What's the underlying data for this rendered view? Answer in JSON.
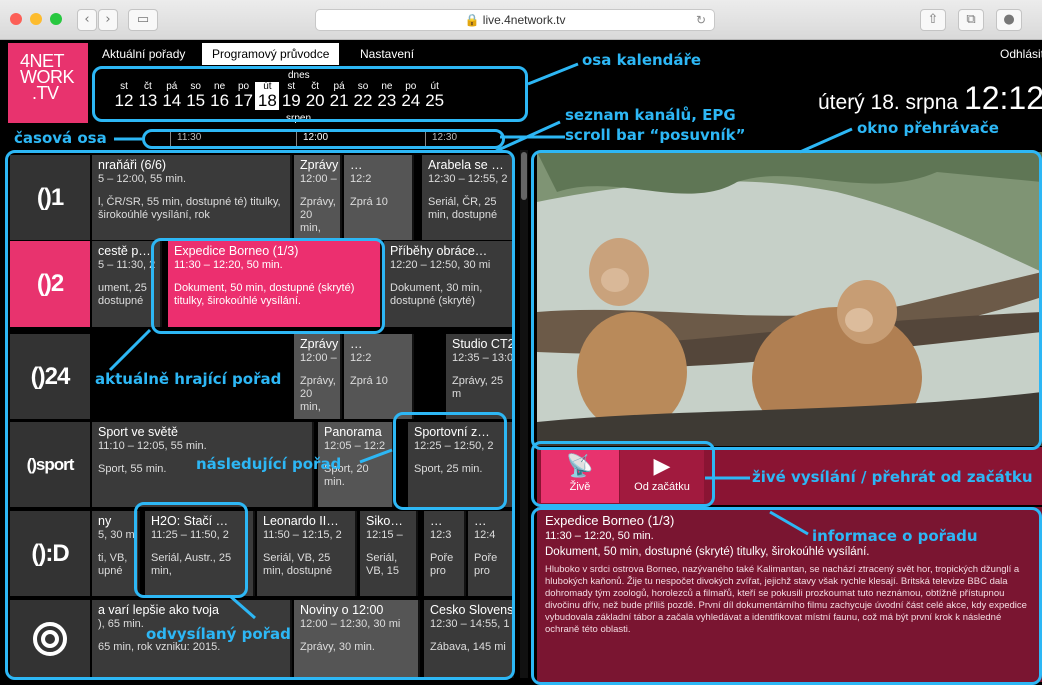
{
  "browser": {
    "url": "live.4network.tv",
    "icons": [
      "back-icon",
      "forward-icon",
      "sidebar-icon",
      "reload-icon",
      "share-icon",
      "tabs-icon",
      "download-icon"
    ]
  },
  "logo": {
    "line1": "4",
    "line2": "NET",
    "line3": "WORK",
    "line4": ".TV"
  },
  "menu": {
    "items": [
      "Aktuální pořady",
      "Programový průvodce",
      "Nastavení"
    ],
    "active": 1,
    "logout": "Odhlásit"
  },
  "calendar": {
    "today_label": "dnes",
    "month_label": "srpen",
    "days": [
      {
        "dw": "st",
        "dn": "12"
      },
      {
        "dw": "čt",
        "dn": "13"
      },
      {
        "dw": "pá",
        "dn": "14"
      },
      {
        "dw": "so",
        "dn": "15"
      },
      {
        "dw": "ne",
        "dn": "16"
      },
      {
        "dw": "po",
        "dn": "17"
      },
      {
        "dw": "út",
        "dn": "18"
      },
      {
        "dw": "st",
        "dn": "19"
      },
      {
        "dw": "čt",
        "dn": "20"
      },
      {
        "dw": "pá",
        "dn": "21"
      },
      {
        "dw": "so",
        "dn": "22"
      },
      {
        "dw": "ne",
        "dn": "23"
      },
      {
        "dw": "po",
        "dn": "24"
      },
      {
        "dw": "út",
        "dn": "25"
      }
    ],
    "today_index": 6
  },
  "date": {
    "text": "úterý 18. srpna",
    "clock": "12:12"
  },
  "timeline": {
    "ticks": [
      "11:30",
      "12:00",
      "12:30"
    ]
  },
  "channels": [
    {
      "name": "ČT1",
      "logo": "()1",
      "programs": [
        {
          "t": "nraňáři (6/6)",
          "tm": "5 – 12:00, 55 min.",
          "d": "l, ČR/SR, 55 min, dostupné té) titulky, širokoúhlé vysílání, rok"
        },
        {
          "t": "Zprávy …",
          "tm": "12:00 – 12:2",
          "d": "Zprávy, 20 min,"
        },
        {
          "t": "…",
          "tm": "12:2",
          "d": "Zprá 10"
        },
        {
          "t": "Arabela se …",
          "tm": "12:30 – 12:55, 2",
          "d": "Seriál, ČR, 25 min, dostupné"
        }
      ]
    },
    {
      "name": "ČT2",
      "logo": "()2",
      "programs": [
        {
          "t": "cestě p…",
          "tm": "5 – 11:30, 2",
          "d": "ument, 25 dostupné"
        },
        {
          "t": "Expedice Borneo (1/3)",
          "tm": "11:30 – 12:20, 50 min.",
          "d": "Dokument, 50 min, dostupné (skryté) titulky, širokoúhlé vysílání."
        },
        {
          "t": "Příběhy obráce…",
          "tm": "12:20 – 12:50, 30 mi",
          "d": "Dokument, 30 min, dostupné (skryté)"
        }
      ]
    },
    {
      "name": "ČT24",
      "logo": "()24",
      "programs": [
        {
          "t": "Zprávy …",
          "tm": "12:00 – 12:2",
          "d": "Zprávy, 20 min,"
        },
        {
          "t": "…",
          "tm": "12:2",
          "d": "Zprá 10"
        },
        {
          "t": "Studio CT2",
          "tm": "12:35 – 13:0",
          "d": "Zprávy, 25 m"
        }
      ]
    },
    {
      "name": "ČT sport",
      "logo": "()sport",
      "programs": [
        {
          "t": "Sport ve světě",
          "tm": "11:10 – 12:05, 55 min.",
          "d": "Sport, 55 min."
        },
        {
          "t": "Panorama",
          "tm": "12:05 – 12:2",
          "d": "Sport, 20 min."
        },
        {
          "t": "Sportovní z…",
          "tm": "12:25 – 12:50, 2",
          "d": "Sport, 25 min."
        }
      ]
    },
    {
      "name": "ČT:D",
      "logo": "():D",
      "programs": [
        {
          "t": "ny",
          "tm": "5, 30 mi",
          "d": "ti, VB, upné"
        },
        {
          "t": "H2O: Stačí …",
          "tm": "11:25 – 11:50, 2",
          "d": "Seriál, Austr., 25 min,"
        },
        {
          "t": "Leonardo II…",
          "tm": "11:50 – 12:15, 2",
          "d": "Seriál, VB, 25 min, dostupné"
        },
        {
          "t": "Siko…",
          "tm": "12:15 –",
          "d": "Seriál, VB, 15"
        },
        {
          "t": "…",
          "tm": "12:3",
          "d": "Poře pro"
        },
        {
          "t": "…",
          "tm": "12:4",
          "d": "Poře pro"
        }
      ]
    },
    {
      "name": "Markíza",
      "logo": "",
      "programs": [
        {
          "t": "a varí lepšie ako tvoja",
          "tm": "), 65 min.",
          "d": "65 min, rok vzniku: 2015."
        },
        {
          "t": "Noviny o 12:00",
          "tm": "12:00 – 12:30, 30 mi",
          "d": "Zprávy, 30 min."
        },
        {
          "t": "Cesko Slovens",
          "tm": "12:30 – 14:55, 1",
          "d": "Zábava, 145 mi"
        }
      ]
    }
  ],
  "player": {
    "live_label": "Živě",
    "restart_label": "Od začátku",
    "icons": [
      "live-broadcast-icon",
      "play-icon"
    ]
  },
  "info": {
    "title": "Expedice Borneo (1/3)",
    "time": "11:30 – 12:20, 50 min.",
    "meta": "Dokument, 50 min, dostupné (skryté) titulky, širokoúhlé vysílání.",
    "description": "Hluboko v srdci ostrova Borneo, nazývaného také Kalimantan, se nachází ztracený svět hor, tropických džunglí a hlubokých kaňonů. Žije tu nespočet divokých zvířat, jejichž stavy však rychle klesají. Britská televize BBC dala dohromady tým zoologů, horolezců a filmařů, kteří se pokusili prozkoumat tuto neznámou, obtížně přístupnou divočinu dřív, než bude příliš pozdě. První díl dokumentárního filmu zachycuje úvodní část celé akce, kdy expedice vybudovala základní tábor a začala vyhledávat a identifikovat místní faunu, což má být první krok k následné ochraně této oblasti."
  },
  "annotations": {
    "calendar": "osa kalendáře",
    "channels": "seznam kanálů, EPG",
    "scroll": "scroll bar “posuvník”",
    "timeline": "časová osa",
    "player": "okno přehrávače",
    "current": "aktuálně hrající pořad",
    "next": "následující pořad",
    "past": "odvysílaný pořad",
    "live": "živé vysílání / přehrát od začátku",
    "info": "informace o pořadu"
  },
  "colors": {
    "accent": "#e8336e",
    "annotation": "#2db7f5",
    "info_bg": "#7a1531"
  }
}
